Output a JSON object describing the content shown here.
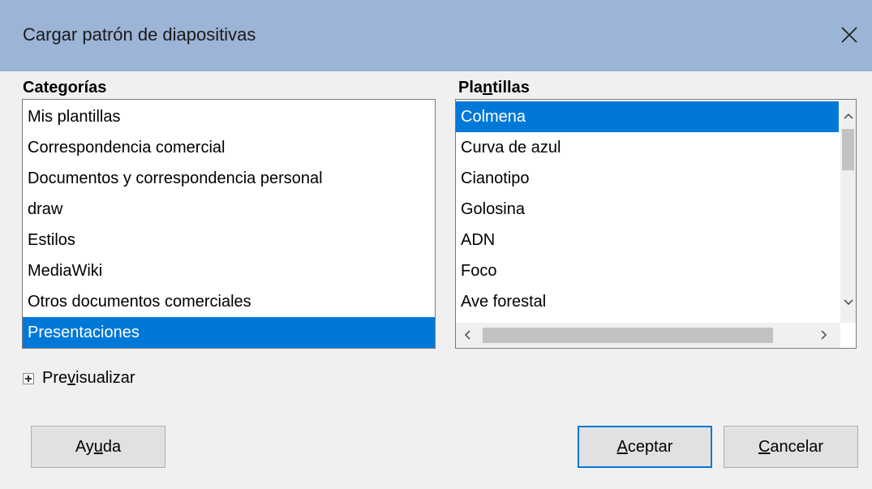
{
  "window": {
    "title": "Cargar patrón de diapositivas"
  },
  "categories": {
    "label": "Categorías",
    "items": [
      "Mis plantillas",
      "Correspondencia comercial",
      "Documentos y correspondencia personal",
      "draw",
      "Estilos",
      "MediaWiki",
      "Otros documentos comerciales",
      "Presentaciones"
    ],
    "selected": "Presentaciones"
  },
  "templates": {
    "label": "Plantillas",
    "items": [
      "Colmena",
      "Curva de azul",
      "Cianotipo",
      "Golosina",
      "ADN",
      "Foco",
      "Ave forestal"
    ],
    "selected": "Colmena"
  },
  "preview": {
    "label": "Previsualizar"
  },
  "buttons": {
    "help": "Ayuda",
    "ok": "Aceptar",
    "cancel": "Cancelar"
  },
  "colors": {
    "selection": "#0078d7",
    "titlebar": "#9cb4d6"
  }
}
